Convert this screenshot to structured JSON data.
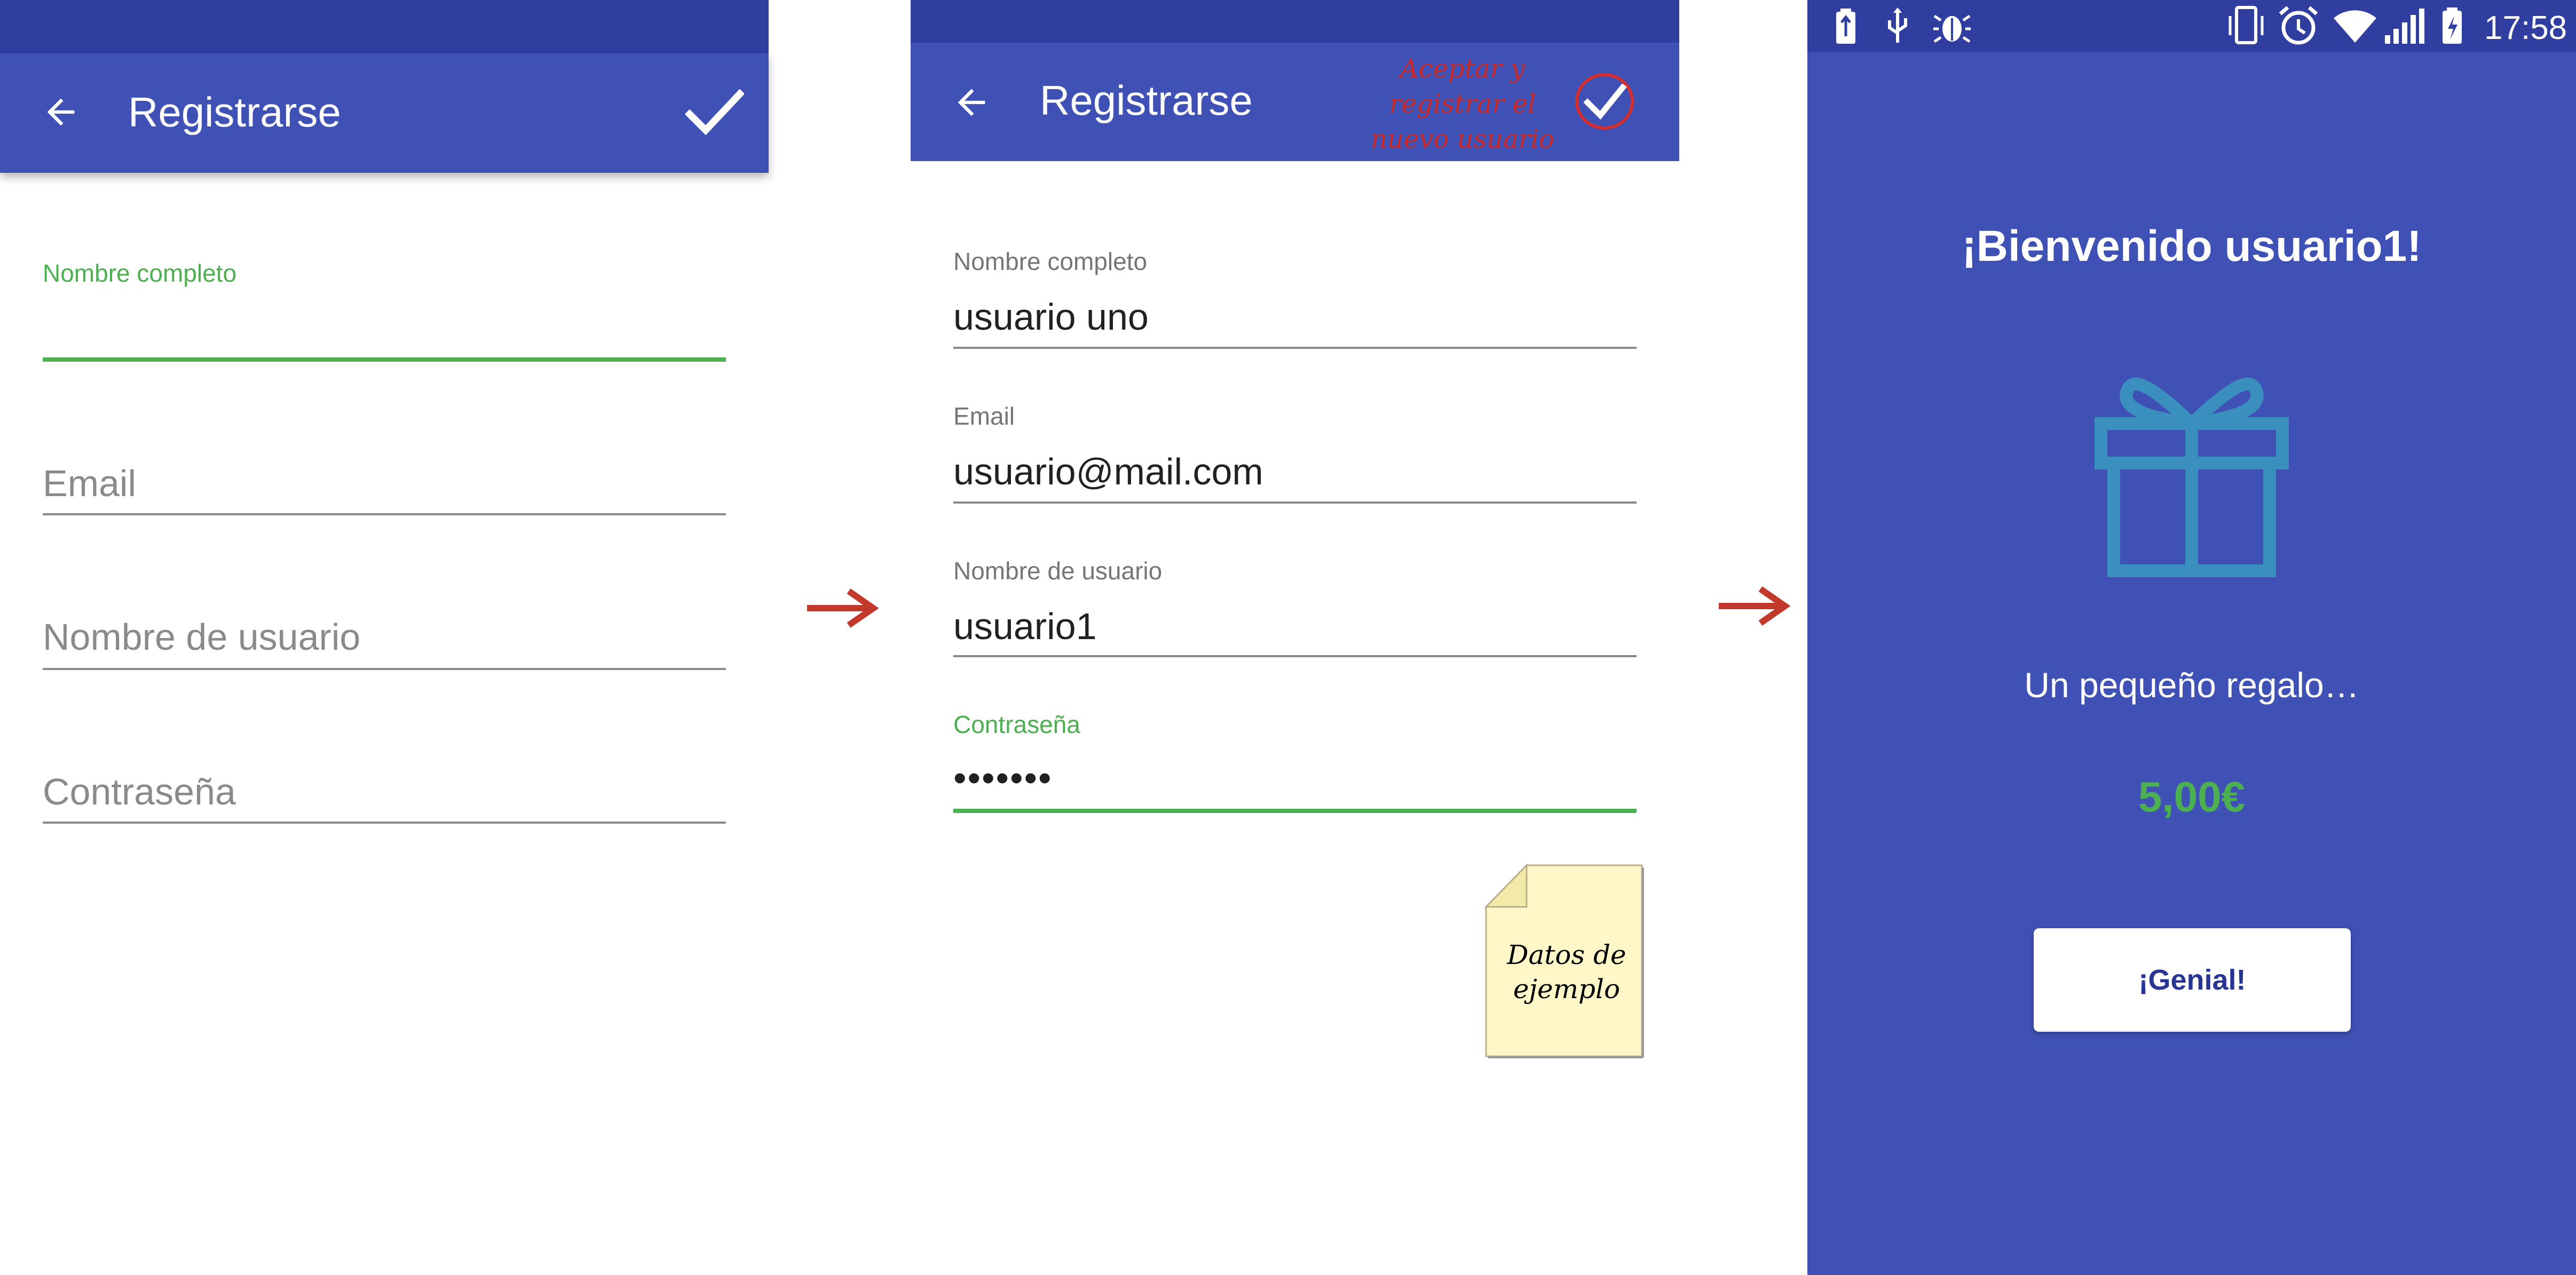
{
  "screen1": {
    "title": "Registrarse",
    "fields": [
      {
        "label": "Nombre completo"
      },
      {
        "placeholder": "Email"
      },
      {
        "placeholder": "Nombre de usuario"
      },
      {
        "placeholder": "Contraseña"
      }
    ]
  },
  "screen2": {
    "title": "Registrarse",
    "annotation": "Aceptar y registrar el nuevo usuario",
    "fields": [
      {
        "label": "Nombre completo",
        "value": "usuario uno"
      },
      {
        "label": "Email",
        "value": "usuario@mail.com"
      },
      {
        "label": "Nombre de usuario",
        "value": "usuario1"
      },
      {
        "label": "Contraseña",
        "value": "•••••••"
      }
    ],
    "note": "Datos de ejemplo"
  },
  "screen3": {
    "status_time": "17:58",
    "welcome": "¡Bienvenido usuario1!",
    "message": "Un pequeño regalo…",
    "amount": "5,00€",
    "button": "¡Genial!"
  },
  "colors": {
    "primary": "#3f51b5",
    "primary_dark": "#303f9f",
    "accent_green": "#4caf50",
    "gift_teal": "#3a8fbf",
    "annotation_red": "#c62828"
  },
  "icons": [
    "back-arrow-icon",
    "check-icon",
    "gift-icon",
    "flow-arrow-icon",
    "battery-icon",
    "usb-icon",
    "bug-icon",
    "vibrate-icon",
    "alarm-icon",
    "wifi-icon",
    "signal-icon",
    "battery-charging-icon"
  ]
}
